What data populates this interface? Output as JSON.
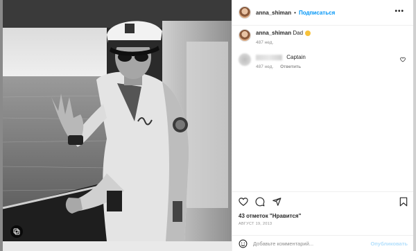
{
  "post": {
    "username": "anna_shiman",
    "follow_label": "Подписаться",
    "more_label": "•••",
    "caption_username": "anna_shiman",
    "caption_text": "Dad",
    "caption_time": "487 нед.",
    "comments": [
      {
        "text": "Captain",
        "time": "487 нед.",
        "reply_label": "Ответить"
      }
    ],
    "likes": "43 отметок \"Нравится\"",
    "date": "АВГУСТ 19, 2013",
    "add_comment_placeholder": "Добавьте комментарий...",
    "publish_label": "Опубликовать"
  },
  "colors": {
    "accent": "#0095f6",
    "publish_disabled": "#b2dffc",
    "muted": "#8e8e8e"
  },
  "icons": [
    "heart-icon",
    "comment-icon",
    "share-icon",
    "bookmark-icon",
    "emoji-icon",
    "carousel-icon"
  ]
}
